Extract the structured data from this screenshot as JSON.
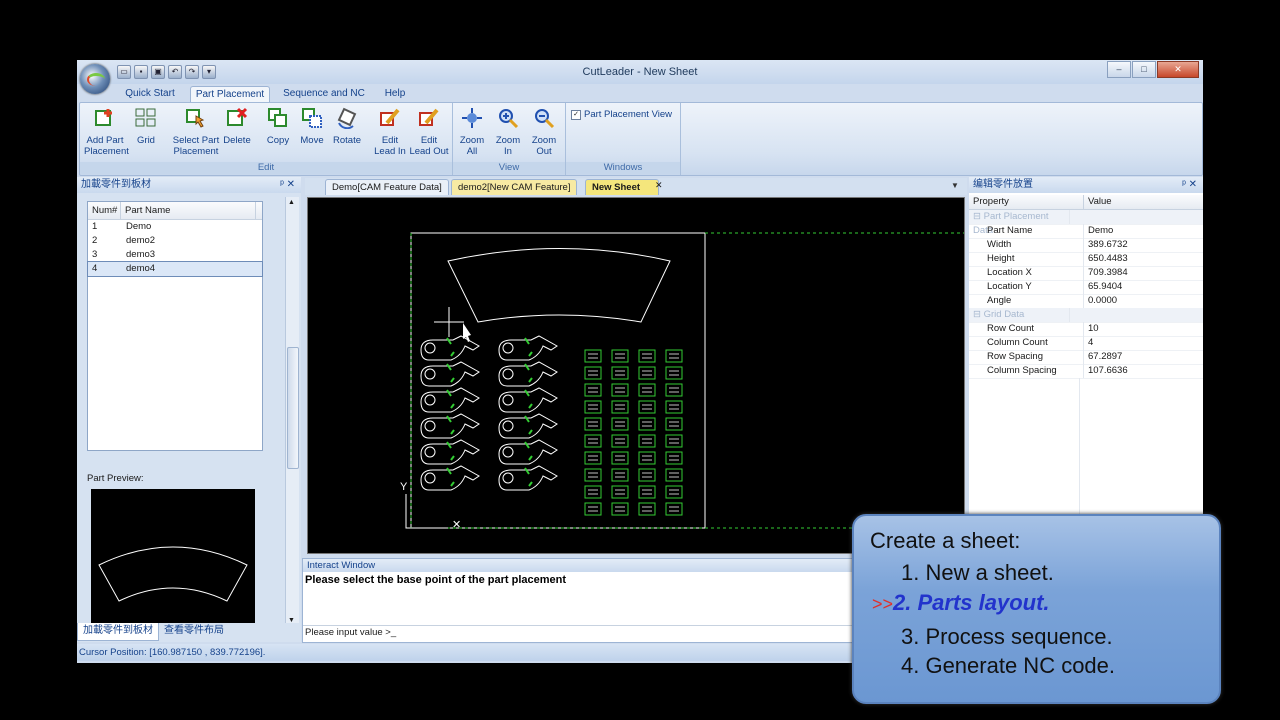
{
  "window": {
    "title": "CutLeader - New Sheet",
    "controls": [
      "–",
      "□",
      "✕"
    ]
  },
  "ribbon": {
    "tabs": [
      "Quick Start",
      "Part Placement",
      "Sequence and NC",
      "Help"
    ],
    "active_tab": "Part Placement",
    "groups": {
      "edit": {
        "label": "Edit",
        "buttons": [
          {
            "label": "Add Part\nPlacement",
            "icon": "add-part-placement-icon"
          },
          {
            "label": "Grid",
            "icon": "grid-icon"
          },
          {
            "label": "Select Part\nPlacement",
            "icon": "select-part-icon"
          },
          {
            "label": "Delete",
            "icon": "delete-icon"
          },
          {
            "label": "Copy",
            "icon": "copy-icon"
          },
          {
            "label": "Move",
            "icon": "move-icon"
          },
          {
            "label": "Rotate",
            "icon": "rotate-icon"
          },
          {
            "label": "Edit\nLead In",
            "icon": "edit-lead-in-icon"
          },
          {
            "label": "Edit\nLead Out",
            "icon": "edit-lead-out-icon"
          }
        ]
      },
      "view": {
        "label": "View",
        "buttons": [
          {
            "label": "Zoom\nAll",
            "icon": "zoom-all-icon"
          },
          {
            "label": "Zoom\nIn",
            "icon": "zoom-in-icon"
          },
          {
            "label": "Zoom\nOut",
            "icon": "zoom-out-icon"
          }
        ]
      },
      "windows": {
        "label": "Windows",
        "checkbox_label": "Part Placement View",
        "checked": true
      }
    }
  },
  "left_panel": {
    "title": "加載零件到板材",
    "columns": [
      "Num#",
      "Part Name"
    ],
    "rows": [
      {
        "num": "1",
        "name": "Demo"
      },
      {
        "num": "2",
        "name": "demo2"
      },
      {
        "num": "3",
        "name": "demo3"
      },
      {
        "num": "4",
        "name": "demo4"
      }
    ],
    "selected_index": 3,
    "preview_label": "Part Preview:",
    "bottom_tabs": [
      "加載零件到板材",
      "查看零件布局"
    ]
  },
  "documents": {
    "tabs": [
      "Demo[CAM Feature Data]",
      "demo2[New CAM Feature]",
      "New Sheet"
    ],
    "active": "New Sheet"
  },
  "interact": {
    "title": "Interact Window",
    "message": "Please select the base point of the part placement",
    "prompt": "Please input value >_"
  },
  "right_panel": {
    "title": "编辑零件放置",
    "columns": [
      "Property",
      "Value"
    ],
    "categories": [
      {
        "name": "Part Placement Data",
        "rows": [
          {
            "name": "Part Name",
            "value": "Demo"
          },
          {
            "name": "Width",
            "value": "389.6732"
          },
          {
            "name": "Height",
            "value": "650.4483"
          },
          {
            "name": "Location X",
            "value": "709.3984"
          },
          {
            "name": "Location Y",
            "value": "65.9404"
          },
          {
            "name": "Angle",
            "value": "0.0000"
          }
        ]
      },
      {
        "name": "Grid Data",
        "rows": [
          {
            "name": "Row Count",
            "value": "10"
          },
          {
            "name": "Column Count",
            "value": "4"
          },
          {
            "name": "Row Spacing",
            "value": "67.2897"
          },
          {
            "name": "Column Spacing",
            "value": "107.6636"
          }
        ]
      }
    ]
  },
  "status": {
    "cursor": "Cursor Position: [160.987150 , 839.772196]."
  },
  "note": {
    "title": "Create a sheet:",
    "steps": [
      "1. New a sheet.",
      "2. Parts layout.",
      "3. Process sequence.",
      "4. Generate NC code."
    ],
    "current_marker": ">>",
    "current_index": 1
  },
  "colors": {
    "canvas_bg": "#000000",
    "part_outline": "#ffffff",
    "lead_marks": "#33cc33",
    "note_highlight": "#2233cc",
    "note_arrow": "#e0302a"
  }
}
